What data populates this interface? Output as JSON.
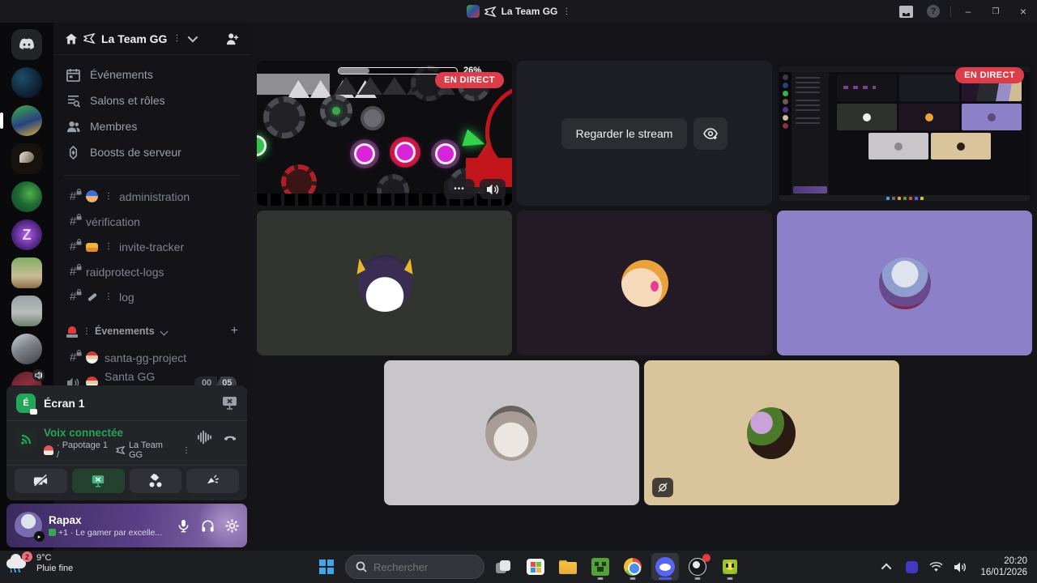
{
  "divider_glyph": "⋮",
  "titlebar": {
    "title": "La Team GG"
  },
  "server_rail": {
    "servers": [
      "discord-home",
      "game-art-server",
      "one-piece-server",
      "swirl-server",
      "shenron-server",
      "z-logo-server",
      "wildunity-server",
      "landscape-server",
      "roblox-server",
      "voice-active-server",
      "anime-server"
    ]
  },
  "sidebar": {
    "server_name": "La Team GG",
    "menu": [
      {
        "icon": "calendar-icon",
        "label": "Événements"
      },
      {
        "icon": "channels-roles-icon",
        "label": "Salons et rôles"
      },
      {
        "icon": "members-icon",
        "label": "Membres"
      },
      {
        "icon": "boost-icon",
        "label": "Boosts de serveur"
      }
    ],
    "channels": [
      {
        "icon": "hash-lock-icon",
        "emoji": "police-officer-emoji",
        "label": "administration"
      },
      {
        "icon": "hash-lock-icon",
        "label": "vérification"
      },
      {
        "icon": "hash-lock-icon",
        "emoji": "ticket-emoji",
        "label": "invite-tracker"
      },
      {
        "icon": "hash-lock-icon",
        "label": "raidprotect-logs"
      },
      {
        "icon": "hash-lock-icon",
        "emoji": "wrench-emoji",
        "label": "log"
      }
    ],
    "category": {
      "emoji": "siren-emoji",
      "label": "Évenements"
    },
    "event_channels": [
      {
        "icon": "hash-lock-icon",
        "emoji": "santa-emoji",
        "label": "santa-gg-project"
      },
      {
        "icon": "speaker-lock-icon",
        "emoji": "santa-emoji",
        "label": "Santa GG Project",
        "count_current": "00",
        "count_max": "05"
      }
    ]
  },
  "screen_share": {
    "title": "Écran 1"
  },
  "voice": {
    "status": "Voix connectée",
    "channel_path": "· Papotage 1 /",
    "server_name": "La Team GG",
    "channel_emoji": "mushroom-emoji"
  },
  "user": {
    "username": "Rapax",
    "status": "+1 · Le gamer par excelle..."
  },
  "stage": {
    "game_stream": {
      "live_badge": "EN DIRECT",
      "progress_label": "26%",
      "progress_value": 26,
      "more_label": "•••"
    },
    "watch_tile": {
      "button_label": "Regarder le stream"
    },
    "mirror_stream": {
      "live_badge": "EN DIRECT"
    }
  },
  "taskbar": {
    "weather": {
      "temperature": "9°C",
      "condition": "Pluie fine",
      "badge_count": "2"
    },
    "search": {
      "placeholder": "Rechercher"
    },
    "clock": {
      "time": "20:20",
      "date": "16/01/2026"
    }
  },
  "colors": {
    "live_badge_red": "#dc3d4b",
    "voice_green": "#23a55a",
    "discord_blurple": "#5865f2",
    "tile_user_purple": "#8c80c9",
    "tile_grey": "#c9c6c9",
    "tile_tan": "#d9c49c",
    "tile_dark_green": "#31342f",
    "tile_dark_purple": "#241a25"
  }
}
